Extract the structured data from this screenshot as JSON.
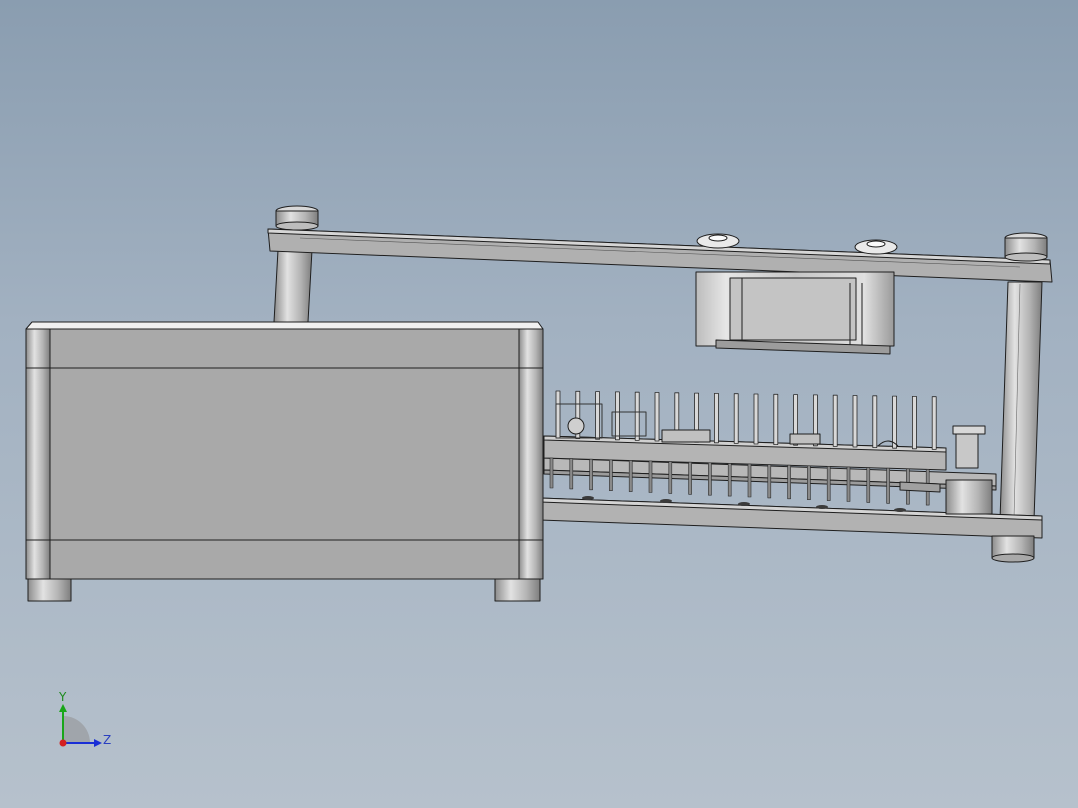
{
  "viewport": {
    "background_top": "#8a9db0",
    "background_bottom": "#b6c1cc"
  },
  "model": {
    "part_fill": "#a9a9a9",
    "part_light": "#d4d4d4",
    "part_dark": "#8a8a8a",
    "edge_color": "#1e1e1e"
  },
  "triad": {
    "y_label": "Y",
    "z_label": "Z",
    "y_color": "#19a619",
    "z_color": "#1a2fd6",
    "x_color": "#d42020"
  }
}
